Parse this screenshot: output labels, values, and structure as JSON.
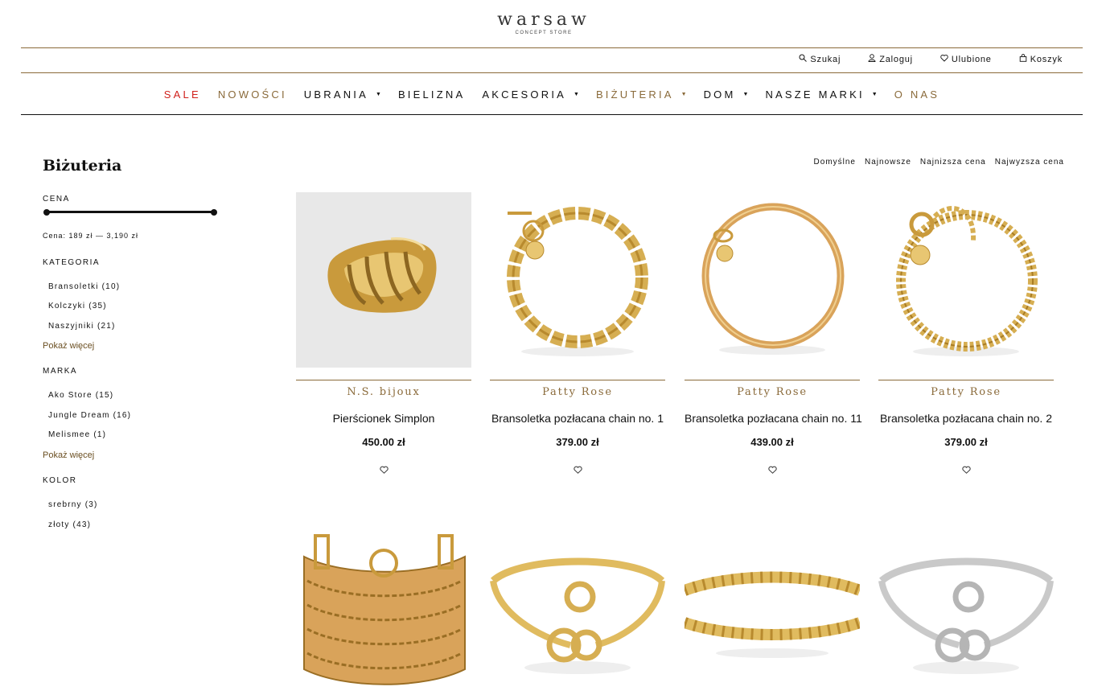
{
  "brand": {
    "name": "warsaw",
    "tagline": "CONCEPT STORE"
  },
  "util_nav": [
    {
      "label": "Szukaj",
      "icon": "search-icon"
    },
    {
      "label": "Zaloguj",
      "icon": "user-icon"
    },
    {
      "label": "Ulubione",
      "icon": "heart-icon"
    },
    {
      "label": "Koszyk",
      "icon": "bag-icon"
    }
  ],
  "main_nav": [
    {
      "label": "SALE",
      "color": "#d0211c",
      "dropdown": false
    },
    {
      "label": "NOWOŚCI",
      "color": "#8a6a3a",
      "dropdown": false
    },
    {
      "label": "UBRANIA",
      "color": "#111111",
      "dropdown": true
    },
    {
      "label": "BIELIZNA",
      "color": "#111111",
      "dropdown": false
    },
    {
      "label": "AKCESORIA",
      "color": "#111111",
      "dropdown": true
    },
    {
      "label": "BIŻUTERIA",
      "color": "#8a6a3a",
      "dropdown": true
    },
    {
      "label": "DOM",
      "color": "#111111",
      "dropdown": true
    },
    {
      "label": "NASZE MARKI",
      "color": "#111111",
      "dropdown": true
    },
    {
      "label": "O NAS",
      "color": "#8a6a3a",
      "dropdown": false
    }
  ],
  "page": {
    "title": "Biżuteria"
  },
  "filters": {
    "price_label": "CENA",
    "price_text": "Cena: 189 zł — 3,190 zł",
    "category_label": "KATEGORIA",
    "categories": [
      "Bransoletki (10)",
      "Kolczyki (35)",
      "Naszyjniki (21)"
    ],
    "show_more": "Pokaż więcej",
    "brand_label": "MARKA",
    "brands": [
      "Ako Store (15)",
      "Jungle Dream (16)",
      "Melismee (1)"
    ],
    "color_label": "KOLOR",
    "colors": [
      "srebrny (3)",
      "złoty (43)"
    ]
  },
  "sort": [
    "Domyślne",
    "Najnowsze",
    "Najnizsza cena",
    "Najwyzsza cena"
  ],
  "products": [
    {
      "brand": "N.S. bijoux",
      "name": "Pierścionek Simplon",
      "price": "450.00 zł"
    },
    {
      "brand": "Patty Rose",
      "name": "Bransoletka pozłacana chain no. 1",
      "price": "379.00 zł"
    },
    {
      "brand": "Patty Rose",
      "name": "Bransoletka pozłacana chain no. 11",
      "price": "439.00 zł"
    },
    {
      "brand": "Patty Rose",
      "name": "Bransoletka pozłacana chain no. 2",
      "price": "379.00 zł"
    }
  ],
  "colors": {
    "gold": "#8a6a3a",
    "sale": "#d0211c",
    "jewel_gold": "#d6ae52",
    "silver": "#c9c9c9"
  }
}
